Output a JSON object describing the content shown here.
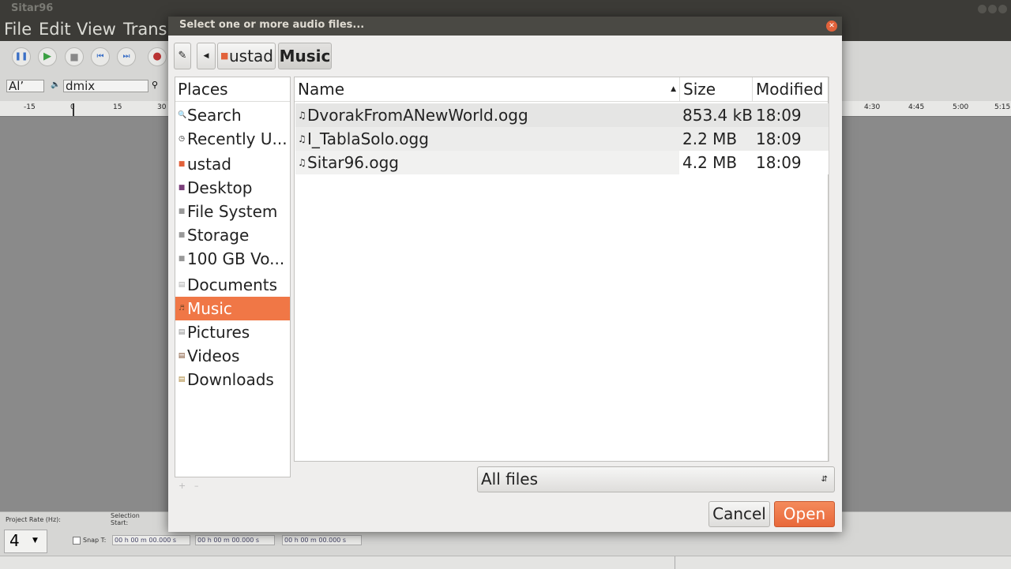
{
  "app": {
    "window_title": "Sitar96",
    "menu": [
      "File",
      "Edit",
      "View",
      "Trans"
    ],
    "device_left": "Al’",
    "device": "dmix",
    "ruler_ticks": [
      "-15",
      "0",
      "15",
      "30",
      "4:30",
      "4:45",
      "5:00",
      "5:15"
    ],
    "project_rate_label": "Project Rate (Hz):",
    "project_rate_value": "4",
    "selection_label": "Selection\nStart:",
    "snap_label": "Snap T:",
    "time_value": "00 h 00 m 00.000 s"
  },
  "dialog": {
    "title": "Select one or more audio files...",
    "path": [
      "ustad",
      "Music"
    ],
    "places_header": "Places",
    "places": [
      {
        "label": "Search",
        "icon": "search-icon"
      },
      {
        "label": "Recently U...",
        "icon": "clock-icon"
      },
      {
        "label": "ustad",
        "icon": "home-folder-icon"
      },
      {
        "label": "Desktop",
        "icon": "desktop-icon"
      },
      {
        "label": "File System",
        "icon": "drive-icon"
      },
      {
        "label": "Storage",
        "icon": "drive-icon"
      },
      {
        "label": "100 GB Vo...",
        "icon": "drive-icon"
      },
      {
        "label": "Documents",
        "icon": "folder-icon"
      },
      {
        "label": "Music",
        "icon": "music-folder-icon",
        "selected": true
      },
      {
        "label": "Pictures",
        "icon": "folder-icon"
      },
      {
        "label": "Videos",
        "icon": "folder-icon"
      },
      {
        "label": "Downloads",
        "icon": "folder-icon"
      }
    ],
    "columns": {
      "name": "Name",
      "size": "Size",
      "modified": "Modified"
    },
    "files": [
      {
        "name": "DvorakFromANewWorld.ogg",
        "size": "853.4 kB",
        "modified": "18:09"
      },
      {
        "name": "I_TablaSolo.ogg",
        "size": "2.2 MB",
        "modified": "18:09"
      },
      {
        "name": "Sitar96.ogg",
        "size": "4.2 MB",
        "modified": "18:09"
      }
    ],
    "filter": "All files",
    "cancel_label": "Cancel",
    "open_label": "Open",
    "accent": "#f07746"
  }
}
